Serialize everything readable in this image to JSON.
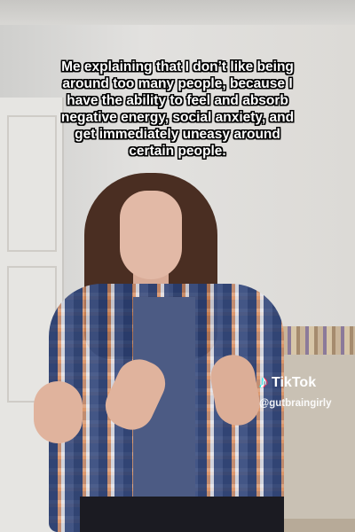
{
  "caption": "Me explaining that I don’t like being around too many people, because I have the ability to feel and absorb negative energy, social anxiety, and get immediately uneasy around certain people.",
  "watermark": {
    "logo_icon": "tiktok-note-icon",
    "brand": "TikTok",
    "handle": "@gutbraingirly"
  }
}
